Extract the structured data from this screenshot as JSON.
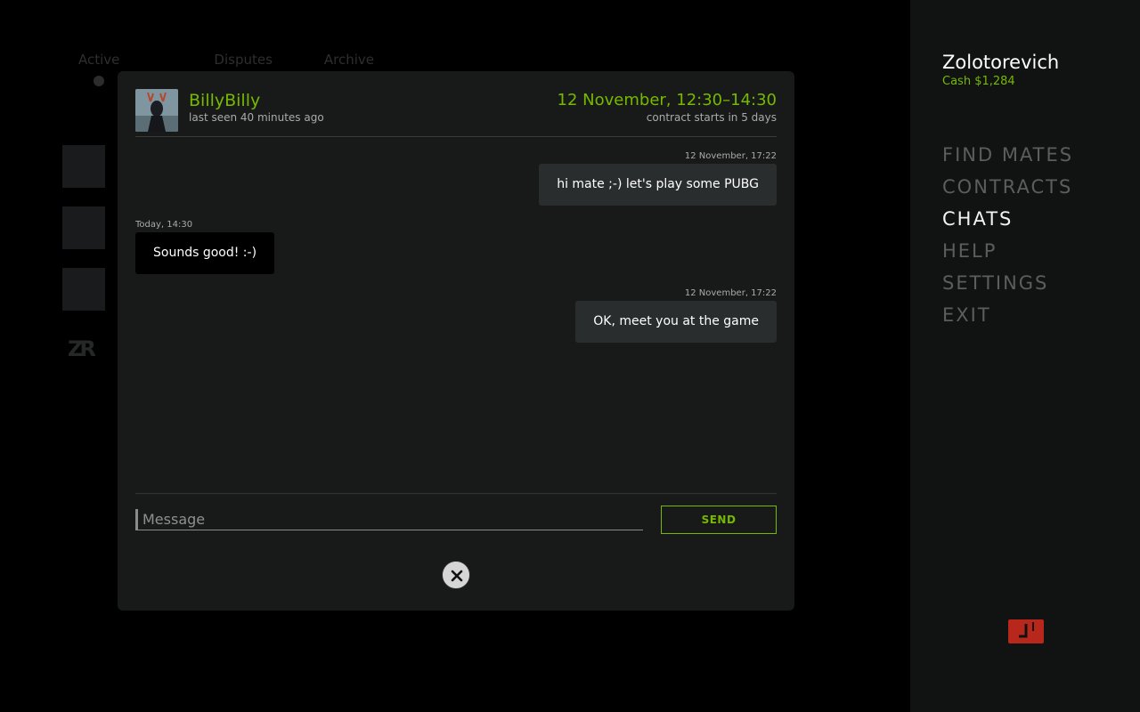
{
  "background": {
    "tabs": [
      "Active",
      "Disputes",
      "Archive"
    ]
  },
  "sidebar": {
    "user_name": "Zolotorevich",
    "cash": "Cash $1,284",
    "nav": [
      {
        "label": "FIND MATES",
        "active": false
      },
      {
        "label": "CONTRACTS",
        "active": false
      },
      {
        "label": "CHATS",
        "active": true
      },
      {
        "label": "HELP",
        "active": false
      },
      {
        "label": "SETTINGS",
        "active": false
      },
      {
        "label": "EXIT",
        "active": false
      }
    ]
  },
  "chat": {
    "peer_name": "BillyBilly",
    "peer_status": "last seen 40 minutes ago",
    "contract_time": "12 November, 12:30–14:30",
    "contract_note": "contract starts in 5 days",
    "messages": [
      {
        "direction": "out",
        "time": "12 November, 17:22",
        "text": "hi mate ;-) let's play some PUBG"
      },
      {
        "direction": "in",
        "time": "Today, 14:30",
        "text": "Sounds good! :-)"
      },
      {
        "direction": "out",
        "time": "12 November, 17:22",
        "text": "OK, meet you at the game"
      }
    ],
    "input": {
      "placeholder": "Message",
      "value": ""
    },
    "send_label": "SEND"
  },
  "colors": {
    "accent": "#76b900",
    "badge": "#b7271b"
  }
}
